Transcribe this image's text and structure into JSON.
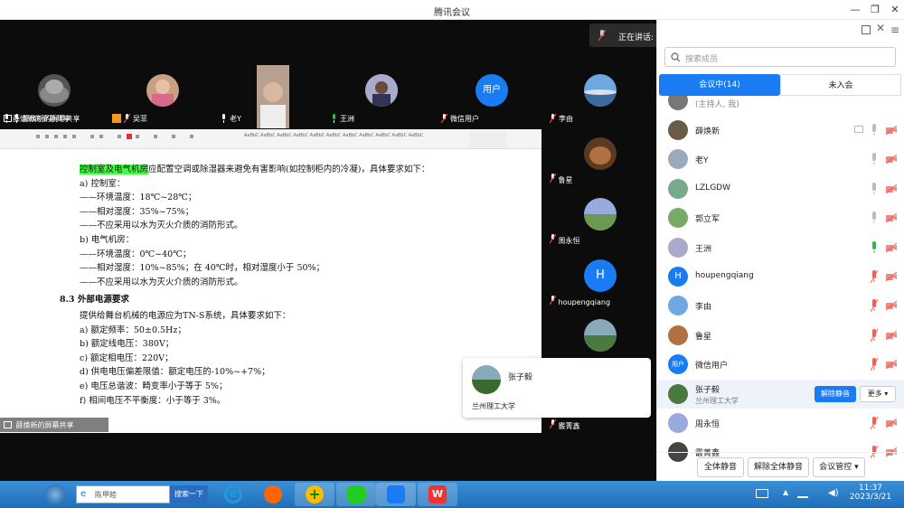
{
  "window": {
    "title": "腾讯会议"
  },
  "speaking": {
    "text": "正在讲话: 王洲"
  },
  "top_thumbs": [
    {
      "name": "薛焕新的屏幕共享"
    },
    {
      "name": "吴菲"
    },
    {
      "name": "老Y"
    },
    {
      "name": "王洲"
    },
    {
      "name": "微信用户",
      "avatar_text": "用户"
    },
    {
      "name": "李由"
    }
  ],
  "side_thumbs": [
    {
      "name": "鲁星"
    },
    {
      "name": "周永恒"
    },
    {
      "name": "houpengqiang",
      "avatar_text": "H"
    },
    {
      "name": "霰菁鑫"
    }
  ],
  "doc": {
    "lines": [
      {
        "hl": "控制室及电气机房",
        "text": "应配置空调或除湿器来避免有害影响(如控制柜内的冷凝)，具体要求如下："
      },
      {
        "text": "a)   控制室："
      },
      {
        "text": "——环境温度：18℃~28℃；"
      },
      {
        "text": "——相对湿度：35%~75%；"
      },
      {
        "text": "——不应采用以水为灭火介质的消防形式。"
      },
      {
        "text": "b)   电气机房："
      },
      {
        "text": "——环境温度：0℃~40℃；"
      },
      {
        "text": "——相对湿度：10%~85%；在 40℃时，相对湿度小于 50%；"
      },
      {
        "text": "——不应采用以水为灭火介质的消防形式。"
      },
      {
        "text": "8.3  外部电源要求"
      },
      {
        "text": "提供给舞台机械的电源应为TN-S系统，具体要求如下："
      },
      {
        "text": "a)   额定频率：50±0.5Hz；"
      },
      {
        "text": "b)   额定线电压：380V；"
      },
      {
        "text": "c)   额定相电压：220V；"
      },
      {
        "text": "d)   供电电压偏差限值：额定电压的-10%~+7%；"
      },
      {
        "text": "e)   电压总谐波：畸变率小于等于 5%；"
      },
      {
        "text": "f)   相间电压不平衡度：小于等于 3%。"
      }
    ],
    "share_label": "薛焕新的屏幕共享"
  },
  "card": {
    "name": "张子毅",
    "org": "兰州理工大学"
  },
  "panel": {
    "search_placeholder": "搜索成员",
    "tab_in": "会议中(14)",
    "tab_out": "未入会",
    "host_note": "(主持人, 我)",
    "members": [
      {
        "name": "薛焕新",
        "mic": "off",
        "cam": "off"
      },
      {
        "name": "老Y",
        "mic": "off",
        "cam": "off"
      },
      {
        "name": "LZLGDW",
        "mic": "off",
        "cam": "off"
      },
      {
        "name": "郭立军",
        "mic": "off",
        "cam": "off"
      },
      {
        "name": "王洲",
        "mic": "on",
        "cam": "off"
      },
      {
        "name": "houpengqiang",
        "avatar_text": "H",
        "mic": "muted",
        "cam": "off"
      },
      {
        "name": "李由",
        "mic": "muted",
        "cam": "off"
      },
      {
        "name": "鲁星",
        "mic": "muted",
        "cam": "off"
      },
      {
        "name": "微信用户",
        "avatar_text": "用户",
        "mic": "muted",
        "cam": "off"
      },
      {
        "name": "张子毅",
        "sub": "兰州理工大学",
        "mic": "muted",
        "cam": "off"
      },
      {
        "name": "周永恒",
        "mic": "muted",
        "cam": "off"
      },
      {
        "name": "霰菁鑫",
        "mic": "muted",
        "cam": "off"
      }
    ],
    "unmute_btn": "解除静音",
    "more_btn": "更多",
    "mute_all": "全体静音",
    "unmute_all": "解除全体静音",
    "manage": "会议管控"
  },
  "taskbar": {
    "search_text": "陈甲睦",
    "search_btn": "搜索一下",
    "time": "11:37",
    "date": "2023/3/21"
  },
  "colors": {
    "accent": "#1a7cf4",
    "mic_on": "#2db84c",
    "mic_muted": "#ff5a4d"
  }
}
